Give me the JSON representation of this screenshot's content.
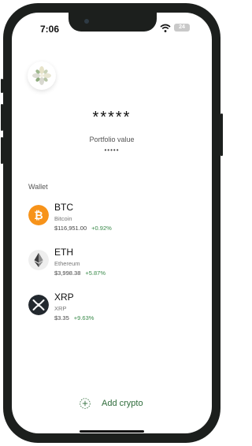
{
  "status_bar": {
    "time": "7:06",
    "battery": "24"
  },
  "portfolio": {
    "value": "*****",
    "label": "Portfolio value",
    "sub": "•••••"
  },
  "wallet": {
    "label": "Wallet",
    "assets": [
      {
        "symbol": "BTC",
        "name": "Bitcoin",
        "price": "$116,951.00",
        "change": "+0.92%",
        "icon": "bitcoin-icon",
        "color": "#f7931a"
      },
      {
        "symbol": "ETH",
        "name": "Ethereum",
        "price": "$3,998.38",
        "change": "+5.87%",
        "icon": "ethereum-icon",
        "color": "#eeeeee"
      },
      {
        "symbol": "XRP",
        "name": "XRP",
        "price": "$3.35",
        "change": "+9.63%",
        "icon": "xrp-icon",
        "color": "#23292f"
      }
    ]
  },
  "add_crypto": {
    "label": "Add crypto",
    "color": "#2e6b3a"
  }
}
